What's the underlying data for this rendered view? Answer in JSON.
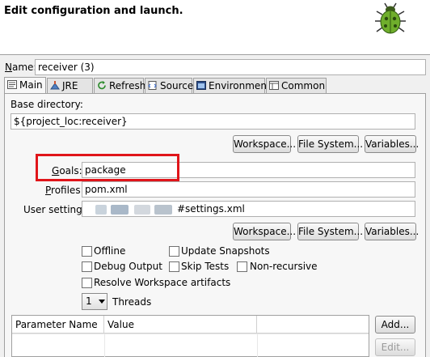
{
  "header": {
    "title": "Edit configuration and launch."
  },
  "name_field": {
    "label": "Name:",
    "value": "receiver (3)"
  },
  "tabs": [
    {
      "label": "Main"
    },
    {
      "label": "JRE"
    },
    {
      "label": "Refresh"
    },
    {
      "label": "Source"
    },
    {
      "label": "Environment"
    },
    {
      "label": "Common"
    }
  ],
  "main": {
    "base_dir_label": "Base directory:",
    "base_dir_value": "${project_loc:receiver}",
    "buttons1": {
      "workspace": "Workspace...",
      "filesystem": "File System...",
      "variables": "Variables..."
    },
    "goals_label": "Goals:",
    "goals_value": "package",
    "profiles_label": "Profiles:",
    "profiles_value": "pom.xml",
    "user_settings_label": "User settings:",
    "user_settings_value": "#settings.xml",
    "buttons2": {
      "workspace": "Workspace...",
      "filesystem": "File System...",
      "variables": "Variables..."
    },
    "checks": {
      "offline": "Offline",
      "update_snapshots": "Update Snapshots",
      "debug_output": "Debug Output",
      "skip_tests": "Skip Tests",
      "non_recursive": "Non-recursive",
      "resolve_workspace": "Resolve Workspace artifacts"
    },
    "threads_value": "1",
    "threads_label": "Threads",
    "table": {
      "col1": "Parameter Name",
      "col2": "Value"
    },
    "add_button": "Add...",
    "edit_button": "Edit..."
  }
}
